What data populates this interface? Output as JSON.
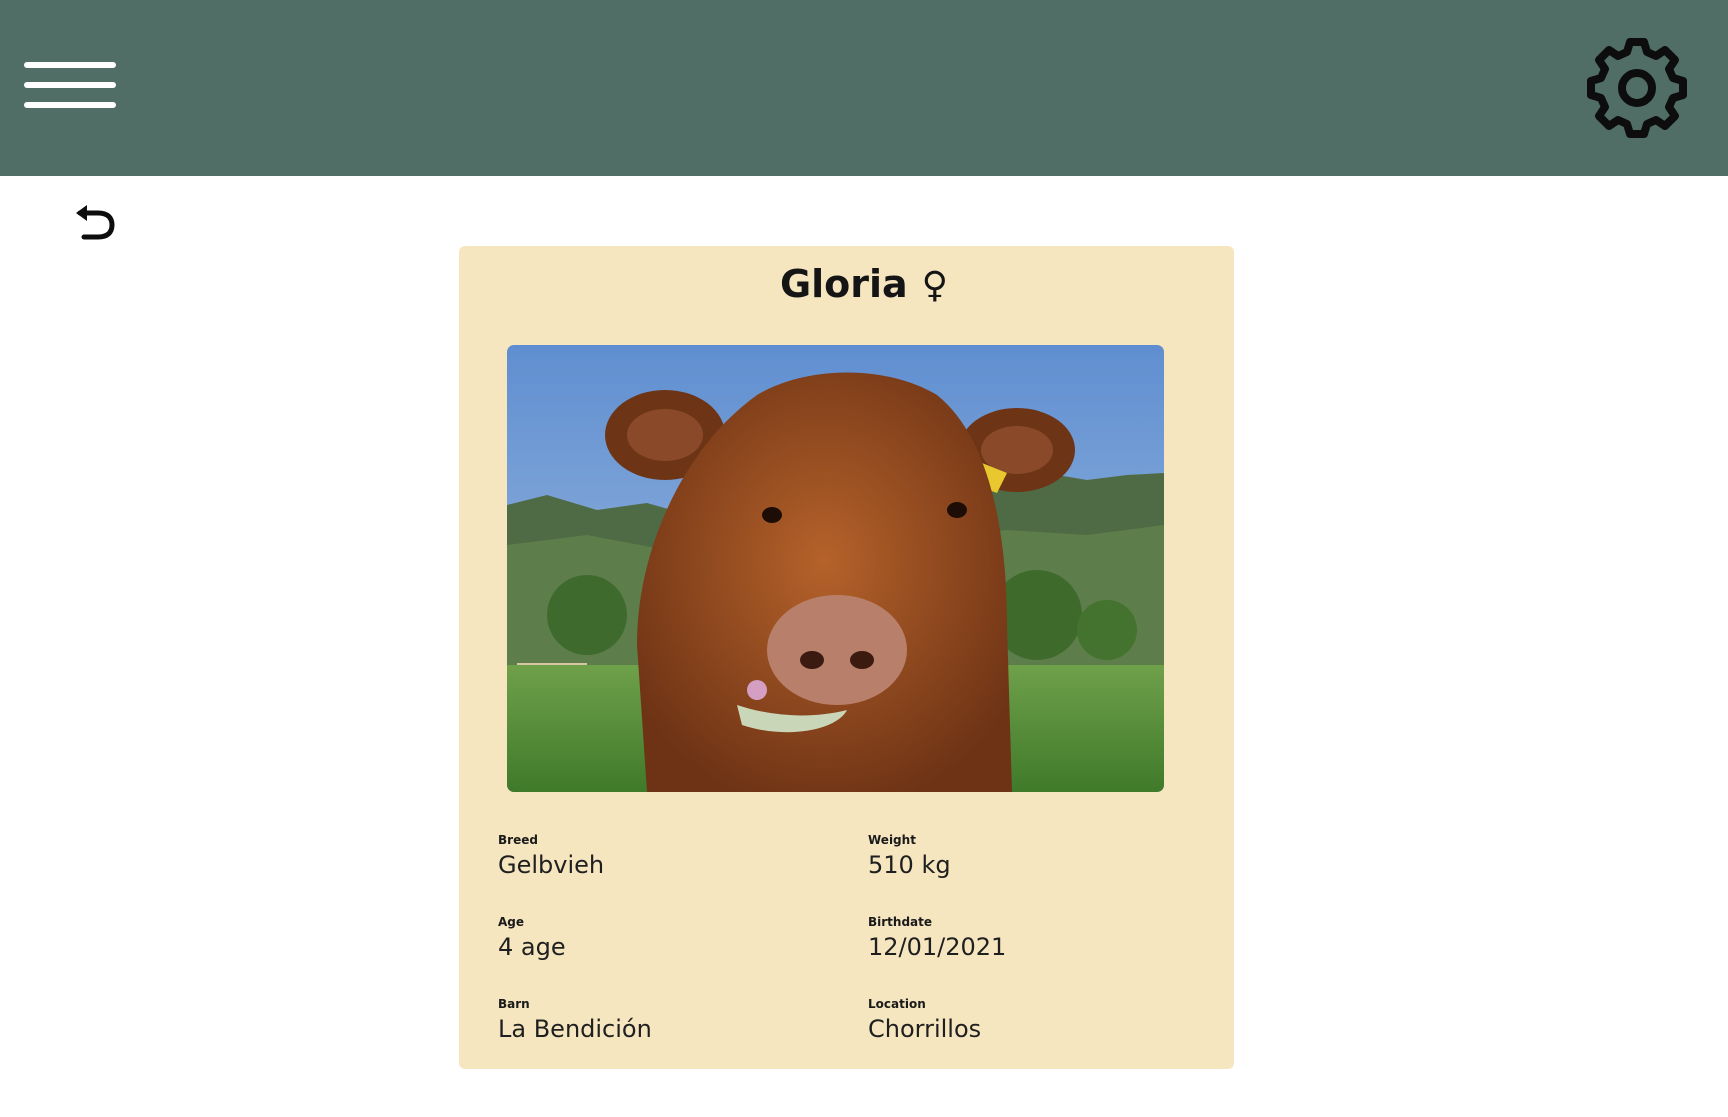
{
  "header": {
    "menu_icon": "hamburger-menu-icon",
    "settings_icon": "gear-icon",
    "background_color": "#516e66"
  },
  "navigation": {
    "back_icon": "undo-arrow-icon"
  },
  "animal": {
    "name": "Gloria",
    "gender_symbol": "♀",
    "photo_description": "Brown cow grazing in a green field with mountains behind",
    "card_color": "#f5e6c0",
    "fields": {
      "breed": {
        "label": "Breed",
        "value": "Gelbvieh"
      },
      "weight": {
        "label": "Weight",
        "value": "510 kg"
      },
      "age": {
        "label": "Age",
        "value": "4 age"
      },
      "birthdate": {
        "label": "Birthdate",
        "value": "12/01/2021"
      },
      "barn": {
        "label": "Barn",
        "value": "La Bendición"
      },
      "location": {
        "label": "Location",
        "value": "Chorrillos"
      }
    }
  }
}
